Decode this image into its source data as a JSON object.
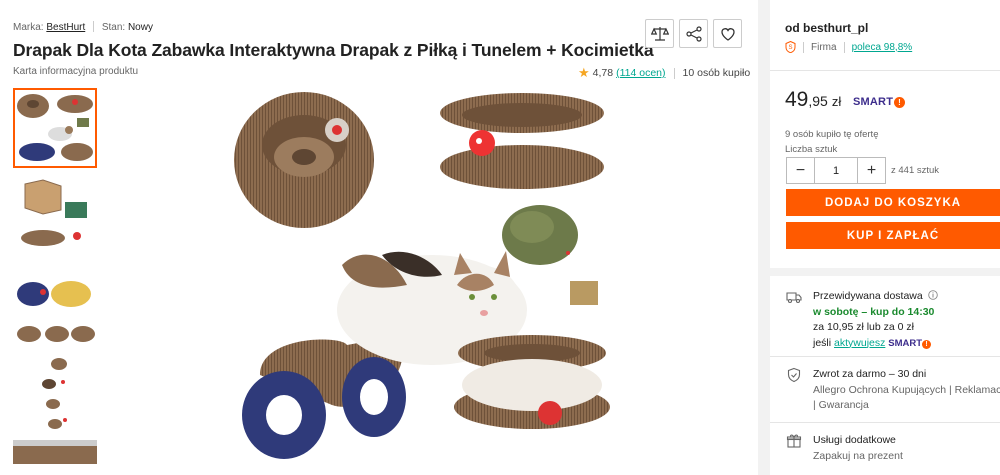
{
  "meta": {
    "brand_label": "Marka:",
    "brand_value": "BestHurt",
    "condition_label": "Stan:",
    "condition_value": "Nowy"
  },
  "product": {
    "title": "Drapak Dla Kota Zabawka Interaktywna Drapak z Piłką i Tunelem + Kocimietka",
    "info_card": "Karta informacyjna produktu",
    "rating": "4,78",
    "reviews": "(114 ocen)",
    "bought_count": "10 osób kupiło"
  },
  "icons": [
    "compare-scale-icon",
    "share-icon",
    "heart-icon"
  ],
  "seller": {
    "name": "od besthurt_pl",
    "type": "Firma",
    "recommend": "poleca 98,8%"
  },
  "offer": {
    "price_int": "49",
    "price_dec": ",95",
    "currency": "zł",
    "smart_label": "SMART",
    "smart_badge": "!",
    "bought_offer": "9 osób kupiło tę ofertę",
    "qty_label": "Liczba sztuk",
    "qty_value": "1",
    "qty_minus": "−",
    "qty_plus": "+",
    "qty_available": "z 441 sztuk",
    "add_to_cart": "DODAJ DO KOSZYKA",
    "buy_now": "KUP I ZAPŁAĆ"
  },
  "delivery": {
    "title": "Przewidywana dostawa",
    "when": "w sobotę",
    "order_by": " – kup do 14:30",
    "cost": "za 10,95 zł lub za 0 zł",
    "if_prefix": "jeśli ",
    "activate_link": "aktywujesz",
    "smart_label": "SMART"
  },
  "returns": {
    "title": "Zwrot za darmo – 30 dni",
    "line2": "Allegro Ochrona Kupujących | Reklamacja",
    "line3": "| Gwarancja"
  },
  "extra": {
    "title": "Usługi dodatkowe",
    "subtitle": "Zapakuj na prezent"
  },
  "colors": {
    "accent_orange": "#ff5a00",
    "link_teal": "#00a790",
    "delivery_green": "#1a8a2e",
    "smart_purple": "#3d2d8c",
    "cardboard": "#8a6a4e"
  }
}
